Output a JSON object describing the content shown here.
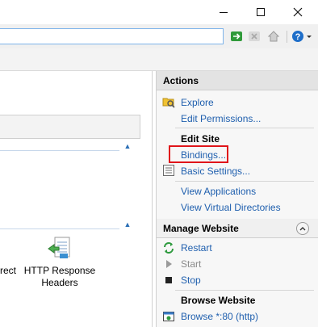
{
  "window": {
    "minimize_icon": "minimize-icon",
    "maximize_icon": "maximize-icon",
    "close_glyph": "✕"
  },
  "address_bar": {
    "value": "",
    "nav_icons": [
      "go-icon",
      "stop-icon",
      "home-icon",
      "help-icon"
    ]
  },
  "content": {
    "feature_left_partial": "rect",
    "feature_http_response_headers": [
      "HTTP Response",
      "Headers"
    ]
  },
  "actions": {
    "header": "Actions",
    "links_top": [
      {
        "label": "Explore",
        "icon": "explore-folder-icon"
      },
      {
        "label": "Edit Permissions..."
      }
    ],
    "edit_site": {
      "title": "Edit Site",
      "bindings": "Bindings...",
      "basic_settings": "Basic Settings...",
      "view_applications": "View Applications",
      "view_virtual_directories": "View Virtual Directories"
    },
    "manage_website": {
      "title": "Manage Website",
      "restart": "Restart",
      "start": "Start",
      "stop": "Stop"
    },
    "browse_website": {
      "title": "Browse Website",
      "browse_80": "Browse *:80 (http)"
    }
  },
  "colors": {
    "link": "#1f5fae",
    "highlight": "#e0141a",
    "header_bg": "#e3e3e3"
  }
}
